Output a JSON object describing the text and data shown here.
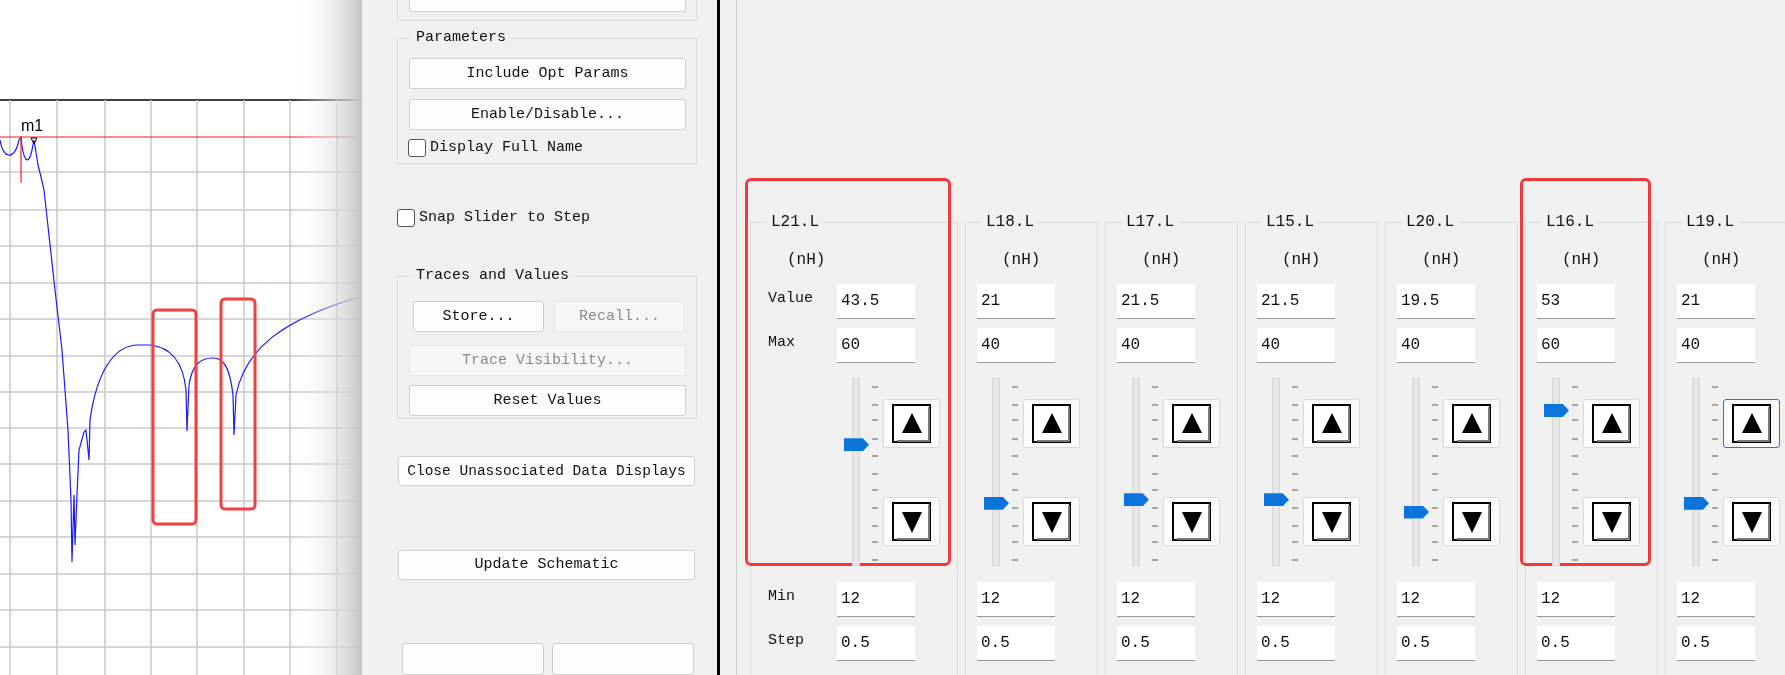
{
  "plot": {
    "marker_label": "m1"
  },
  "tune_panel": {
    "parameters": {
      "legend": "Parameters",
      "buttons": [
        {
          "label": "Include Opt Params",
          "disabled": false
        },
        {
          "label": "Enable/Disable...",
          "disabled": false
        }
      ],
      "display_full_name": {
        "label": "Display Full Name",
        "checked": false
      }
    },
    "snap_slider": {
      "label": "Snap Slider to Step",
      "checked": false
    },
    "traces": {
      "legend": "Traces and Values",
      "store": {
        "label": "Store...",
        "disabled": false
      },
      "recall": {
        "label": "Recall...",
        "disabled": true
      },
      "trace_visibility": {
        "label": "Trace Visibility...",
        "disabled": true
      },
      "reset": {
        "label": "Reset Values",
        "disabled": false
      }
    },
    "close_unassociated": {
      "label": "Close Unassociated Data Displays"
    },
    "update_schematic": {
      "label": "Update Schematic"
    }
  },
  "row_labels": {
    "value": "Value",
    "max": "Max",
    "min": "Min",
    "step": "Step"
  },
  "columns": [
    {
      "title": "L21.L",
      "unit": "(nH)",
      "value": "43.5",
      "max": "60",
      "min": "12",
      "step": "0.5",
      "level": 0.656,
      "highlighted": true,
      "focused": false
    },
    {
      "title": "L18.L",
      "unit": "(nH)",
      "value": "21",
      "max": "40",
      "min": "12",
      "step": "0.5",
      "level": 0.32,
      "highlighted": false,
      "focused": false
    },
    {
      "title": "L17.L",
      "unit": "(nH)",
      "value": "21.5",
      "max": "40",
      "min": "12",
      "step": "0.5",
      "level": 0.34,
      "highlighted": false,
      "focused": false
    },
    {
      "title": "L15.L",
      "unit": "(nH)",
      "value": "21.5",
      "max": "40",
      "min": "12",
      "step": "0.5",
      "level": 0.34,
      "highlighted": false,
      "focused": false
    },
    {
      "title": "L20.L",
      "unit": "(nH)",
      "value": "19.5",
      "max": "40",
      "min": "12",
      "step": "0.5",
      "level": 0.27,
      "highlighted": false,
      "focused": false
    },
    {
      "title": "L16.L",
      "unit": "(nH)",
      "value": "53",
      "max": "60",
      "min": "12",
      "step": "0.5",
      "level": 0.854,
      "highlighted": true,
      "focused": false
    },
    {
      "title": "L19.L",
      "unit": "(nH)",
      "value": "21",
      "max": "40",
      "min": "12",
      "step": "0.5",
      "level": 0.32,
      "highlighted": false,
      "focused": true
    }
  ]
}
